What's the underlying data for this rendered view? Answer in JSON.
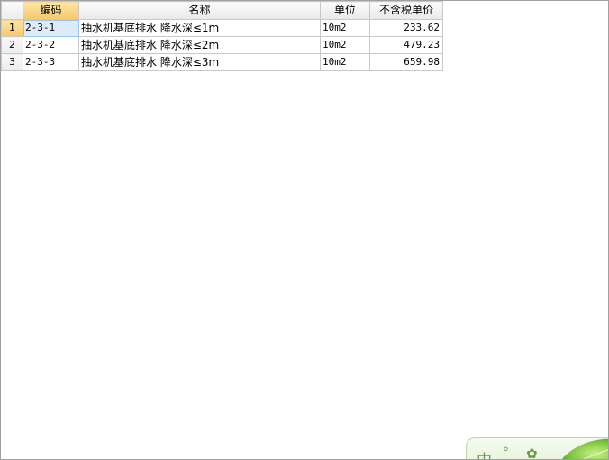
{
  "grid": {
    "headers": {
      "code": "编码",
      "name": "名称",
      "unit": "单位",
      "price": "不含税单价"
    },
    "rows": [
      {
        "num": "1",
        "code": "2-3-1",
        "name": "抽水机基底排水 降水深≤1m",
        "unit": "10m2",
        "price": "233.62"
      },
      {
        "num": "2",
        "code": "2-3-2",
        "name": "抽水机基底排水 降水深≤2m",
        "unit": "10m2",
        "price": "479.23"
      },
      {
        "num": "3",
        "code": "2-3-3",
        "name": "抽水机基底排水 降水深≤3m",
        "unit": "10m2",
        "price": "659.98"
      }
    ]
  },
  "ime_widget": {
    "mode_char": "中",
    "punct_symbol": "°",
    "skin_symbol": "✿",
    "accent_color": "#6c9b4a"
  }
}
